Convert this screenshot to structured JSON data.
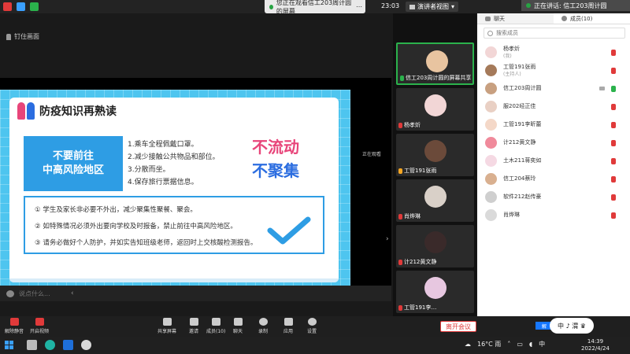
{
  "topbar": {
    "viewing_banner": "您正在观看信工203周计圆的屏幕",
    "view_options": "选项",
    "time": "23:03",
    "view_mode": "演讲者视图",
    "speaking_label": "正在讲话: 信工203周计圆"
  },
  "share": {
    "pin_label": "钉住画面",
    "speaker_tag": "正在观看",
    "chat_placeholder": "说点什么..."
  },
  "slide": {
    "title": "防疫知识再熟读",
    "blue_box_line1": "不要前往",
    "blue_box_line2": "中高风险地区",
    "tips": [
      "1.乘车全程佩戴口罩。",
      "2.减少接触公共物品和部位。",
      "3.分散而坐。",
      "4.保存旅行票据信息。"
    ],
    "slogan_line1": "不流动",
    "slogan_line2": "不聚集",
    "notices": [
      "① 学生及家长非必要不外出，减少聚集性聚餐、聚会。",
      "② 如特殊情况必须外出要向学校及时报备，禁止前往中高风险地区。",
      "③ 请务必做好个人防护，并如实告知班级老师，返回时上交核酸检测报告。"
    ]
  },
  "videos": [
    {
      "name": "信工203周计圆的屏幕共享",
      "color": "#e8c4a0",
      "mic": "share"
    },
    {
      "name": "杨孝炘",
      "color": "#f2d6d6",
      "mic": "muted"
    },
    {
      "name": "工管191张雨",
      "color": "#6b4a3a",
      "mic": "muted"
    },
    {
      "name": "肖烨琳",
      "color": "#d9d0c8",
      "mic": "muted"
    },
    {
      "name": "计212黄文静",
      "color": "#3a2a2a",
      "mic": "muted"
    },
    {
      "name": "工管191李…",
      "color": "#e7c7e0",
      "mic": "muted"
    }
  ],
  "panel": {
    "tab_chat": "聊天",
    "tab_members": "成员(10)",
    "search_placeholder": "搜索成员",
    "members": [
      {
        "name": "杨孝炘",
        "role": "(我)",
        "color": "#f2d6d6",
        "speaking": false
      },
      {
        "name": "工管191张雨",
        "role": "(主持人)",
        "color": "#a57a5a",
        "speaking": false
      },
      {
        "name": "信工203周计圆",
        "role": "",
        "color": "#c8a080",
        "speaking": true
      },
      {
        "name": "服202经正佳",
        "role": "",
        "color": "#e9d0c4",
        "speaking": false
      },
      {
        "name": "工管191李昕蕾",
        "role": "",
        "color": "#f4d8c8",
        "speaking": false
      },
      {
        "name": "计212黄文静",
        "role": "",
        "color": "#f08a9b",
        "speaking": false
      },
      {
        "name": "土木211蒋奕如",
        "role": "",
        "color": "#f5d9e3",
        "speaking": false
      },
      {
        "name": "信工204蔡玲",
        "role": "",
        "color": "#d9b090",
        "speaking": false
      },
      {
        "name": "软件212赵传豪",
        "role": "",
        "color": "#cfcfcf",
        "speaking": false
      },
      {
        "name": "肖烨琳",
        "role": "",
        "color": "#dadada",
        "speaking": false
      }
    ]
  },
  "toolbar": {
    "unmute": "解除静音",
    "start_video": "开启视频",
    "share_screen": "共享屏幕",
    "invite": "邀请",
    "members": "成员(10)",
    "chat": "聊天",
    "record": "录制",
    "apps": "应用",
    "settings": "设置",
    "leave": "离开会议",
    "chip": "解",
    "signature": "中 ♪ 渭 ♛"
  },
  "taskbar": {
    "weather": "16°C 雨",
    "ime": "中",
    "time": "14:39",
    "date": "2022/4/24"
  },
  "colors": {
    "accent_blue": "#2e9de4",
    "slide_bg": "#4ec5ef",
    "leave_red": "#e03a3a",
    "active_green": "#2bb24c"
  }
}
